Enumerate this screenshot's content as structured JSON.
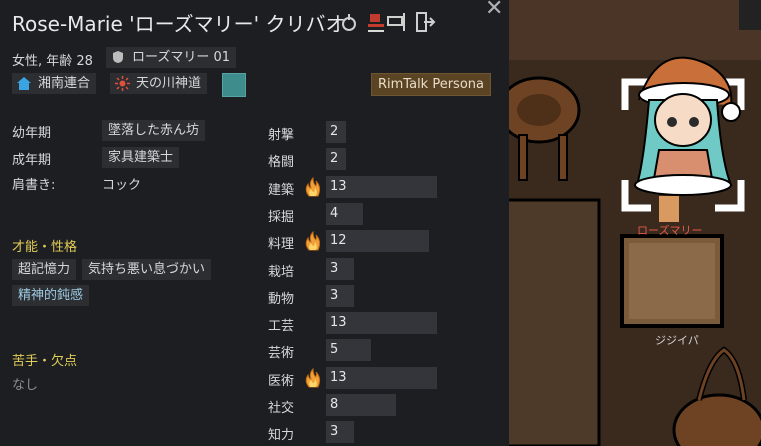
{
  "header": {
    "name": "Rose-Marie 'ローズマリー' クリバオ"
  },
  "info": {
    "gender_age": "女性, 年齢 28",
    "title_tag": "ローズマリー 01",
    "faction": "湘南連合",
    "ideology": "天の川神道",
    "persona_button": "RimTalk Persona"
  },
  "backstory": {
    "childhood_label": "幼年期",
    "childhood_value": "墜落した赤ん坊",
    "adulthood_label": "成年期",
    "adulthood_value": "家具建築士",
    "title_label": "肩書き:",
    "title_value": "コック"
  },
  "traits": {
    "heading": "才能・性格",
    "items": [
      "超記憶力",
      "気持ち悪い息づかい",
      "精神的鈍感"
    ]
  },
  "incapable": {
    "heading": "苦手・欠点",
    "value": "なし"
  },
  "skills": [
    {
      "name": "射撃",
      "value": "2",
      "passion": false,
      "level": 2
    },
    {
      "name": "格闘",
      "value": "2",
      "passion": false,
      "level": 2
    },
    {
      "name": "建築",
      "value": "13",
      "passion": true,
      "level": 13
    },
    {
      "name": "採掘",
      "value": "4",
      "passion": false,
      "level": 4
    },
    {
      "name": "料理",
      "value": "12",
      "passion": true,
      "level": 12
    },
    {
      "name": "栽培",
      "value": "3",
      "passion": false,
      "level": 3
    },
    {
      "name": "動物",
      "value": "3",
      "passion": false,
      "level": 3
    },
    {
      "name": "工芸",
      "value": "13",
      "passion": false,
      "level": 13
    },
    {
      "name": "芸術",
      "value": "5",
      "passion": false,
      "level": 5
    },
    {
      "name": "医術",
      "value": "13",
      "passion": true,
      "level": 13
    },
    {
      "name": "社交",
      "value": "8",
      "passion": false,
      "level": 8
    },
    {
      "name": "知力",
      "value": "3",
      "passion": false,
      "level": 3
    }
  ],
  "world": {
    "pawn_label": "ローズマリー",
    "other_label": "ジジイパ"
  },
  "colors": {
    "accent_yellow": "#e3cf57",
    "teal_tag": "#3e8c8c",
    "persona_bg": "#5b4423"
  }
}
